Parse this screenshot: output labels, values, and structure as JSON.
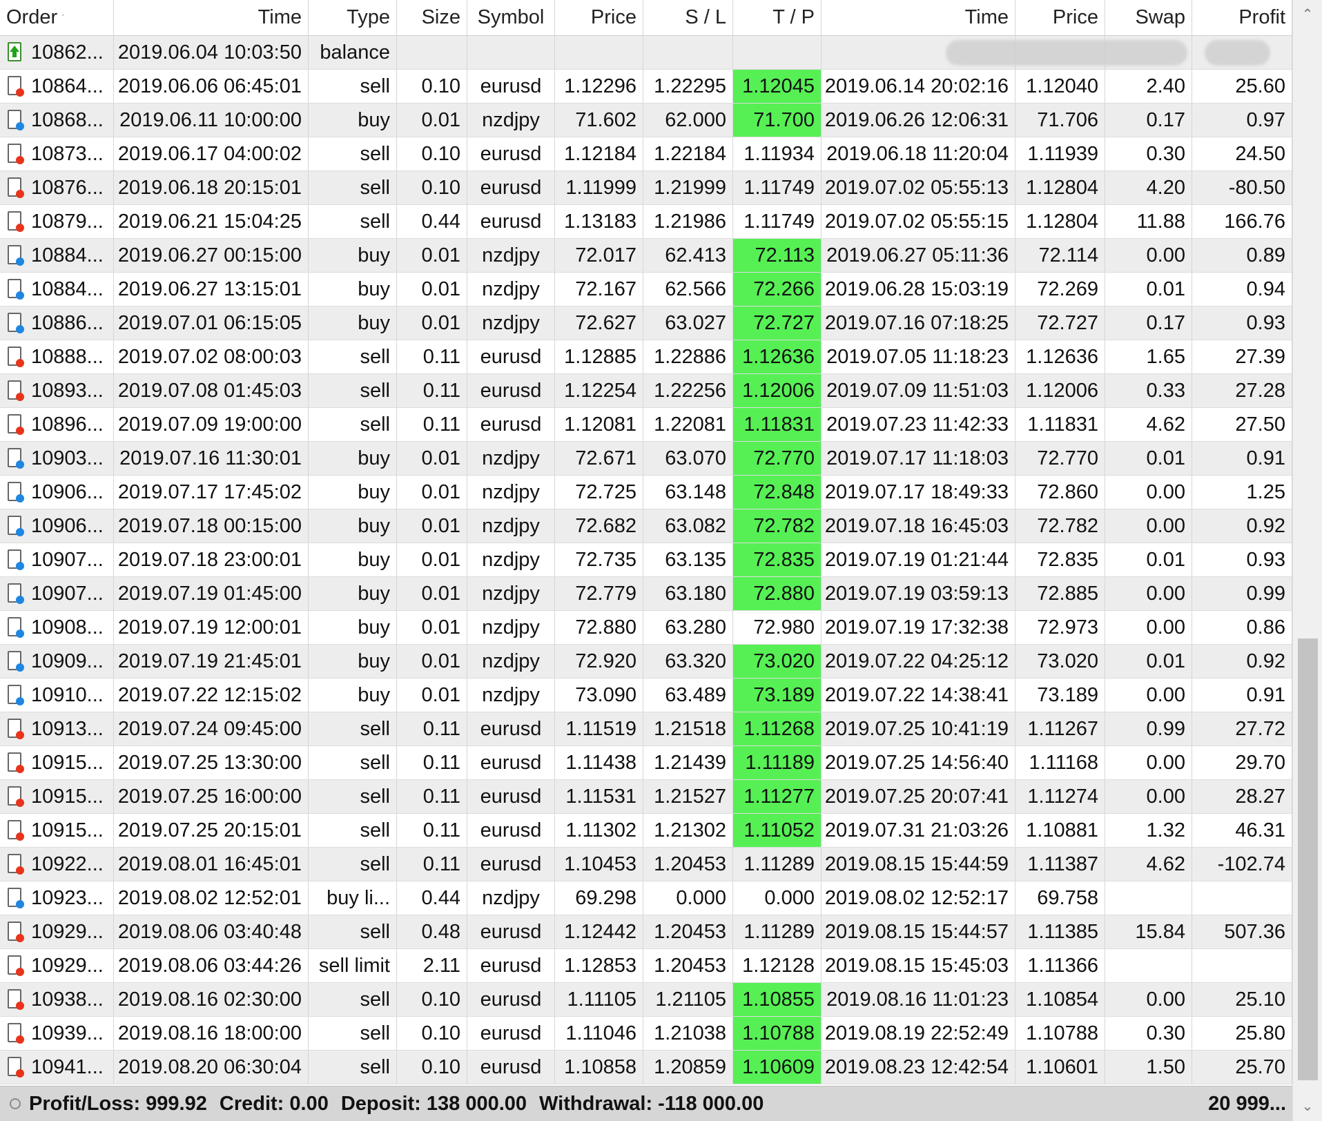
{
  "columns": [
    {
      "label": "Order",
      "align": "l"
    },
    {
      "label": "Time",
      "align": "r"
    },
    {
      "label": "Type",
      "align": "r"
    },
    {
      "label": "Size",
      "align": "r"
    },
    {
      "label": "Symbol",
      "align": "c"
    },
    {
      "label": "Price",
      "align": "r"
    },
    {
      "label": "S / L",
      "align": "r"
    },
    {
      "label": "T / P",
      "align": "r"
    },
    {
      "label": "Time",
      "align": "r"
    },
    {
      "label": "Price",
      "align": "r"
    },
    {
      "label": "Swap",
      "align": "r"
    },
    {
      "label": "Profit",
      "align": "r"
    }
  ],
  "colors": {
    "tp_highlight": "#56f055",
    "sell_icon": "#e8341c",
    "buy_icon": "#1e86e3",
    "balance_icon": "#22a11b"
  },
  "rows": [
    {
      "icon": "balance",
      "order": "10862...",
      "time": "2019.06.04 10:03:50",
      "type": "balance",
      "size": "",
      "symbol": "",
      "price": "",
      "sl": "",
      "tp": "",
      "tp_hit": false,
      "close_time": "",
      "close_price": "",
      "swap": "",
      "profit": "",
      "redacted": true
    },
    {
      "icon": "sell",
      "order": "10864...",
      "time": "2019.06.06 06:45:01",
      "type": "sell",
      "size": "0.10",
      "symbol": "eurusd",
      "price": "1.12296",
      "sl": "1.22295",
      "tp": "1.12045",
      "tp_hit": true,
      "close_time": "2019.06.14 20:02:16",
      "close_price": "1.12040",
      "swap": "2.40",
      "profit": "25.60"
    },
    {
      "icon": "buy",
      "order": "10868...",
      "time": "2019.06.11 10:00:00",
      "type": "buy",
      "size": "0.01",
      "symbol": "nzdjpy",
      "price": "71.602",
      "sl": "62.000",
      "tp": "71.700",
      "tp_hit": true,
      "close_time": "2019.06.26 12:06:31",
      "close_price": "71.706",
      "swap": "0.17",
      "profit": "0.97"
    },
    {
      "icon": "sell",
      "order": "10873...",
      "time": "2019.06.17 04:00:02",
      "type": "sell",
      "size": "0.10",
      "symbol": "eurusd",
      "price": "1.12184",
      "sl": "1.22184",
      "tp": "1.11934",
      "tp_hit": false,
      "close_time": "2019.06.18 11:20:04",
      "close_price": "1.11939",
      "swap": "0.30",
      "profit": "24.50"
    },
    {
      "icon": "sell",
      "order": "10876...",
      "time": "2019.06.18 20:15:01",
      "type": "sell",
      "size": "0.10",
      "symbol": "eurusd",
      "price": "1.11999",
      "sl": "1.21999",
      "tp": "1.11749",
      "tp_hit": false,
      "close_time": "2019.07.02 05:55:13",
      "close_price": "1.12804",
      "swap": "4.20",
      "profit": "-80.50"
    },
    {
      "icon": "sell",
      "order": "10879...",
      "time": "2019.06.21 15:04:25",
      "type": "sell",
      "size": "0.44",
      "symbol": "eurusd",
      "price": "1.13183",
      "sl": "1.21986",
      "tp": "1.11749",
      "tp_hit": false,
      "close_time": "2019.07.02 05:55:15",
      "close_price": "1.12804",
      "swap": "11.88",
      "profit": "166.76"
    },
    {
      "icon": "buy",
      "order": "10884...",
      "time": "2019.06.27 00:15:00",
      "type": "buy",
      "size": "0.01",
      "symbol": "nzdjpy",
      "price": "72.017",
      "sl": "62.413",
      "tp": "72.113",
      "tp_hit": true,
      "close_time": "2019.06.27 05:11:36",
      "close_price": "72.114",
      "swap": "0.00",
      "profit": "0.89"
    },
    {
      "icon": "buy",
      "order": "10884...",
      "time": "2019.06.27 13:15:01",
      "type": "buy",
      "size": "0.01",
      "symbol": "nzdjpy",
      "price": "72.167",
      "sl": "62.566",
      "tp": "72.266",
      "tp_hit": true,
      "close_time": "2019.06.28 15:03:19",
      "close_price": "72.269",
      "swap": "0.01",
      "profit": "0.94"
    },
    {
      "icon": "buy",
      "order": "10886...",
      "time": "2019.07.01 06:15:05",
      "type": "buy",
      "size": "0.01",
      "symbol": "nzdjpy",
      "price": "72.627",
      "sl": "63.027",
      "tp": "72.727",
      "tp_hit": true,
      "close_time": "2019.07.16 07:18:25",
      "close_price": "72.727",
      "swap": "0.17",
      "profit": "0.93"
    },
    {
      "icon": "sell",
      "order": "10888...",
      "time": "2019.07.02 08:00:03",
      "type": "sell",
      "size": "0.11",
      "symbol": "eurusd",
      "price": "1.12885",
      "sl": "1.22886",
      "tp": "1.12636",
      "tp_hit": true,
      "close_time": "2019.07.05 11:18:23",
      "close_price": "1.12636",
      "swap": "1.65",
      "profit": "27.39"
    },
    {
      "icon": "sell",
      "order": "10893...",
      "time": "2019.07.08 01:45:03",
      "type": "sell",
      "size": "0.11",
      "symbol": "eurusd",
      "price": "1.12254",
      "sl": "1.22256",
      "tp": "1.12006",
      "tp_hit": true,
      "close_time": "2019.07.09 11:51:03",
      "close_price": "1.12006",
      "swap": "0.33",
      "profit": "27.28"
    },
    {
      "icon": "sell",
      "order": "10896...",
      "time": "2019.07.09 19:00:00",
      "type": "sell",
      "size": "0.11",
      "symbol": "eurusd",
      "price": "1.12081",
      "sl": "1.22081",
      "tp": "1.11831",
      "tp_hit": true,
      "close_time": "2019.07.23 11:42:33",
      "close_price": "1.11831",
      "swap": "4.62",
      "profit": "27.50"
    },
    {
      "icon": "buy",
      "order": "10903...",
      "time": "2019.07.16 11:30:01",
      "type": "buy",
      "size": "0.01",
      "symbol": "nzdjpy",
      "price": "72.671",
      "sl": "63.070",
      "tp": "72.770",
      "tp_hit": true,
      "close_time": "2019.07.17 11:18:03",
      "close_price": "72.770",
      "swap": "0.01",
      "profit": "0.91"
    },
    {
      "icon": "buy",
      "order": "10906...",
      "time": "2019.07.17 17:45:02",
      "type": "buy",
      "size": "0.01",
      "symbol": "nzdjpy",
      "price": "72.725",
      "sl": "63.148",
      "tp": "72.848",
      "tp_hit": true,
      "close_time": "2019.07.17 18:49:33",
      "close_price": "72.860",
      "swap": "0.00",
      "profit": "1.25"
    },
    {
      "icon": "buy",
      "order": "10906...",
      "time": "2019.07.18 00:15:00",
      "type": "buy",
      "size": "0.01",
      "symbol": "nzdjpy",
      "price": "72.682",
      "sl": "63.082",
      "tp": "72.782",
      "tp_hit": true,
      "close_time": "2019.07.18 16:45:03",
      "close_price": "72.782",
      "swap": "0.00",
      "profit": "0.92"
    },
    {
      "icon": "buy",
      "order": "10907...",
      "time": "2019.07.18 23:00:01",
      "type": "buy",
      "size": "0.01",
      "symbol": "nzdjpy",
      "price": "72.735",
      "sl": "63.135",
      "tp": "72.835",
      "tp_hit": true,
      "close_time": "2019.07.19 01:21:44",
      "close_price": "72.835",
      "swap": "0.01",
      "profit": "0.93"
    },
    {
      "icon": "buy",
      "order": "10907...",
      "time": "2019.07.19 01:45:00",
      "type": "buy",
      "size": "0.01",
      "symbol": "nzdjpy",
      "price": "72.779",
      "sl": "63.180",
      "tp": "72.880",
      "tp_hit": true,
      "close_time": "2019.07.19 03:59:13",
      "close_price": "72.885",
      "swap": "0.00",
      "profit": "0.99"
    },
    {
      "icon": "buy",
      "order": "10908...",
      "time": "2019.07.19 12:00:01",
      "type": "buy",
      "size": "0.01",
      "symbol": "nzdjpy",
      "price": "72.880",
      "sl": "63.280",
      "tp": "72.980",
      "tp_hit": false,
      "close_time": "2019.07.19 17:32:38",
      "close_price": "72.973",
      "swap": "0.00",
      "profit": "0.86"
    },
    {
      "icon": "buy",
      "order": "10909...",
      "time": "2019.07.19 21:45:01",
      "type": "buy",
      "size": "0.01",
      "symbol": "nzdjpy",
      "price": "72.920",
      "sl": "63.320",
      "tp": "73.020",
      "tp_hit": true,
      "close_time": "2019.07.22 04:25:12",
      "close_price": "73.020",
      "swap": "0.01",
      "profit": "0.92"
    },
    {
      "icon": "buy",
      "order": "10910...",
      "time": "2019.07.22 12:15:02",
      "type": "buy",
      "size": "0.01",
      "symbol": "nzdjpy",
      "price": "73.090",
      "sl": "63.489",
      "tp": "73.189",
      "tp_hit": true,
      "close_time": "2019.07.22 14:38:41",
      "close_price": "73.189",
      "swap": "0.00",
      "profit": "0.91"
    },
    {
      "icon": "sell",
      "order": "10913...",
      "time": "2019.07.24 09:45:00",
      "type": "sell",
      "size": "0.11",
      "symbol": "eurusd",
      "price": "1.11519",
      "sl": "1.21518",
      "tp": "1.11268",
      "tp_hit": true,
      "close_time": "2019.07.25 10:41:19",
      "close_price": "1.11267",
      "swap": "0.99",
      "profit": "27.72"
    },
    {
      "icon": "sell",
      "order": "10915...",
      "time": "2019.07.25 13:30:00",
      "type": "sell",
      "size": "0.11",
      "symbol": "eurusd",
      "price": "1.11438",
      "sl": "1.21439",
      "tp": "1.11189",
      "tp_hit": true,
      "close_time": "2019.07.25 14:56:40",
      "close_price": "1.11168",
      "swap": "0.00",
      "profit": "29.70"
    },
    {
      "icon": "sell",
      "order": "10915...",
      "time": "2019.07.25 16:00:00",
      "type": "sell",
      "size": "0.11",
      "symbol": "eurusd",
      "price": "1.11531",
      "sl": "1.21527",
      "tp": "1.11277",
      "tp_hit": true,
      "close_time": "2019.07.25 20:07:41",
      "close_price": "1.11274",
      "swap": "0.00",
      "profit": "28.27"
    },
    {
      "icon": "sell",
      "order": "10915...",
      "time": "2019.07.25 20:15:01",
      "type": "sell",
      "size": "0.11",
      "symbol": "eurusd",
      "price": "1.11302",
      "sl": "1.21302",
      "tp": "1.11052",
      "tp_hit": true,
      "close_time": "2019.07.31 21:03:26",
      "close_price": "1.10881",
      "swap": "1.32",
      "profit": "46.31"
    },
    {
      "icon": "sell",
      "order": "10922...",
      "time": "2019.08.01 16:45:01",
      "type": "sell",
      "size": "0.11",
      "symbol": "eurusd",
      "price": "1.10453",
      "sl": "1.20453",
      "tp": "1.11289",
      "tp_hit": false,
      "close_time": "2019.08.15 15:44:59",
      "close_price": "1.11387",
      "swap": "4.62",
      "profit": "-102.74"
    },
    {
      "icon": "buy",
      "order": "10923...",
      "time": "2019.08.02 12:52:01",
      "type": "buy li...",
      "size": "0.44",
      "symbol": "nzdjpy",
      "price": "69.298",
      "sl": "0.000",
      "tp": "0.000",
      "tp_hit": false,
      "close_time": "2019.08.02 12:52:17",
      "close_price": "69.758",
      "swap": "",
      "profit": ""
    },
    {
      "icon": "sell",
      "order": "10929...",
      "time": "2019.08.06 03:40:48",
      "type": "sell",
      "size": "0.48",
      "symbol": "eurusd",
      "price": "1.12442",
      "sl": "1.20453",
      "tp": "1.11289",
      "tp_hit": false,
      "close_time": "2019.08.15 15:44:57",
      "close_price": "1.11385",
      "swap": "15.84",
      "profit": "507.36"
    },
    {
      "icon": "sell",
      "order": "10929...",
      "time": "2019.08.06 03:44:26",
      "type": "sell limit",
      "size": "2.11",
      "symbol": "eurusd",
      "price": "1.12853",
      "sl": "1.20453",
      "tp": "1.12128",
      "tp_hit": false,
      "close_time": "2019.08.15 15:45:03",
      "close_price": "1.11366",
      "swap": "",
      "profit": ""
    },
    {
      "icon": "sell",
      "order": "10938...",
      "time": "2019.08.16 02:30:00",
      "type": "sell",
      "size": "0.10",
      "symbol": "eurusd",
      "price": "1.11105",
      "sl": "1.21105",
      "tp": "1.10855",
      "tp_hit": true,
      "close_time": "2019.08.16 11:01:23",
      "close_price": "1.10854",
      "swap": "0.00",
      "profit": "25.10"
    },
    {
      "icon": "sell",
      "order": "10939...",
      "time": "2019.08.16 18:00:00",
      "type": "sell",
      "size": "0.10",
      "symbol": "eurusd",
      "price": "1.11046",
      "sl": "1.21038",
      "tp": "1.10788",
      "tp_hit": true,
      "close_time": "2019.08.19 22:52:49",
      "close_price": "1.10788",
      "swap": "0.30",
      "profit": "25.80"
    },
    {
      "icon": "sell",
      "order": "10941...",
      "time": "2019.08.20 06:30:04",
      "type": "sell",
      "size": "0.10",
      "symbol": "eurusd",
      "price": "1.10858",
      "sl": "1.20859",
      "tp": "1.10609",
      "tp_hit": true,
      "close_time": "2019.08.23 12:42:54",
      "close_price": "1.10601",
      "swap": "1.50",
      "profit": "25.70"
    }
  ],
  "footer": {
    "profit_loss": "Profit/Loss: 999.92",
    "credit": "Credit: 0.00",
    "deposit": "Deposit: 138 000.00",
    "withdrawal": "Withdrawal: -118 000.00",
    "total": "20 999..."
  },
  "scrollbar": {
    "up_icon": "chevron-up-icon",
    "down_icon": "chevron-down-icon"
  }
}
